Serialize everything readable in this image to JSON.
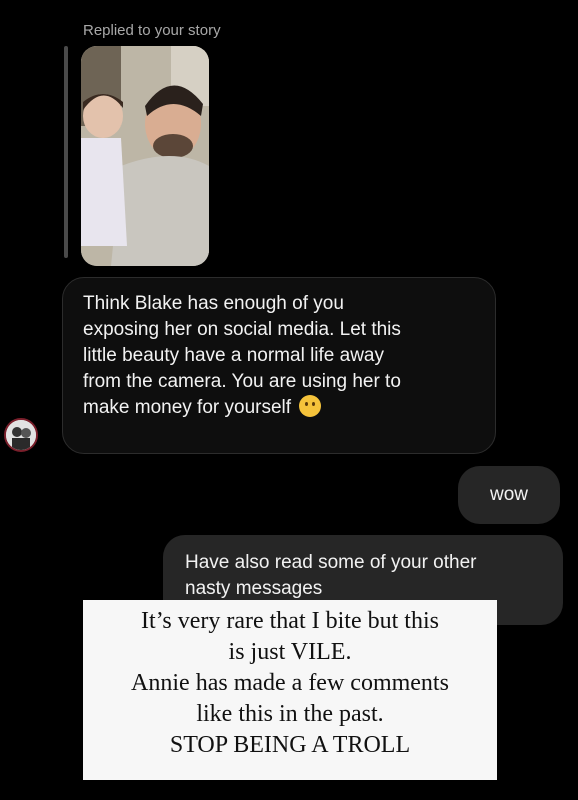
{
  "reply_header": {
    "label": "Replied to your story"
  },
  "story_preview": {
    "icon": "story-photo-thumbnail"
  },
  "incoming_message": {
    "lines": [
      "Think Blake has enough of you",
      "exposing her on social media.  Let this",
      "little beauty have a normal life away",
      "from the camera.  You are using her to",
      "make money for yourself"
    ],
    "emoji": "thinking-face-emoji"
  },
  "sender": {
    "avatar_icon": "profile-avatar"
  },
  "outgoing_messages": [
    {
      "text": "wow"
    },
    {
      "lines": [
        "Have also read some of your other",
        "nasty messages"
      ]
    }
  ],
  "caption": {
    "lines": [
      "It’s very rare that I bite but this",
      "is just VILE.",
      "Annie has made a few comments",
      "like this in the past.",
      "STOP BEING A TROLL"
    ]
  },
  "colors": {
    "background": "#000000",
    "incoming_bubble": "#0e0e0e",
    "outgoing_bubble": "#262626",
    "caption_background": "#f7f7f7"
  }
}
